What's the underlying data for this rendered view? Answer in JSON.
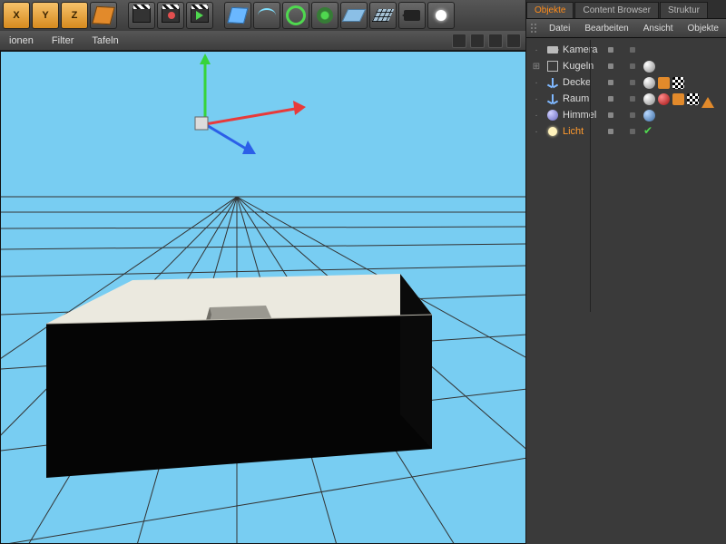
{
  "toolbar": {
    "axis_x": "X",
    "axis_y": "Y",
    "axis_z": "Z"
  },
  "menubar": {
    "items": [
      "ionen",
      "Filter",
      "Tafeln"
    ]
  },
  "tabs": {
    "items": [
      {
        "label": "Objekte",
        "active": true
      },
      {
        "label": "Content Browser",
        "active": false
      },
      {
        "label": "Struktur",
        "active": false
      }
    ]
  },
  "panel_menu": {
    "items": [
      "Datei",
      "Bearbeiten",
      "Ansicht",
      "Objekte"
    ]
  },
  "objects": [
    {
      "name": "Kamera",
      "icon": "cam",
      "selected": false,
      "tree": " ",
      "tags": []
    },
    {
      "name": "Kugeln",
      "icon": "null",
      "selected": false,
      "tree": "+",
      "tags": [
        "sphere"
      ]
    },
    {
      "name": "Decke",
      "icon": "axis",
      "selected": false,
      "tree": " ",
      "tags": [
        "sphere",
        "sq",
        "chk"
      ]
    },
    {
      "name": "Raum",
      "icon": "axis",
      "selected": false,
      "tree": " ",
      "tags": [
        "sphere",
        "red",
        "sq",
        "chk",
        "tri"
      ]
    },
    {
      "name": "Himmel",
      "icon": "sky",
      "selected": false,
      "tree": " ",
      "tags": [
        "blue"
      ]
    },
    {
      "name": "Licht",
      "icon": "light",
      "selected": true,
      "tree": " ",
      "tags": [
        "tick"
      ]
    }
  ],
  "colors": {
    "sky": "#78cdf2",
    "accent": "#ff8c1a"
  }
}
